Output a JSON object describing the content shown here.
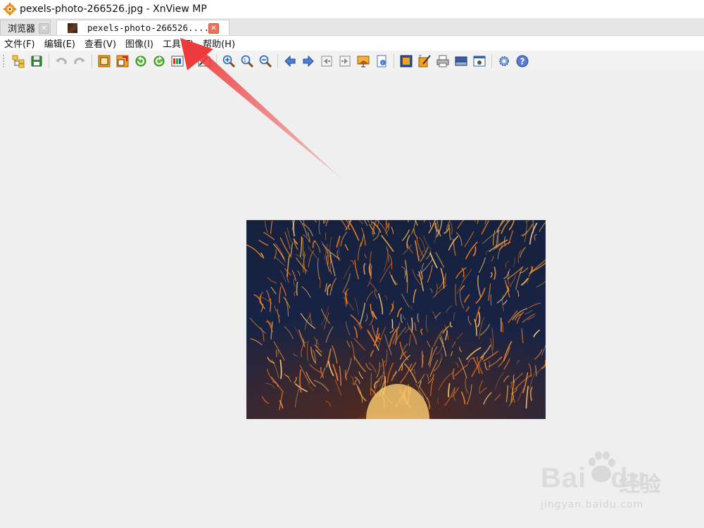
{
  "window": {
    "title": "pexels-photo-266526.jpg - XnView MP"
  },
  "tabs": [
    {
      "label": "浏览器"
    },
    {
      "label": "pexels-photo-266526...."
    }
  ],
  "menu": [
    "文件(F)",
    "编辑(E)",
    "查看(V)",
    "图像(I)",
    "工具(T)",
    "帮助(H)"
  ],
  "toolbar": {
    "buttons": [
      "open-browser-icon",
      "save-icon",
      "undo-icon",
      "redo-icon",
      "crop-icon",
      "resize-icon",
      "rotate-left-icon",
      "rotate-right-icon",
      "adjust-colors-icon",
      "dropdown-arrow-icon",
      "edit-icon",
      "zoom-in-icon",
      "zoom-fit-icon",
      "zoom-out-icon",
      "previous-icon",
      "next-icon",
      "first-icon",
      "last-icon",
      "slideshow-icon",
      "info-icon",
      "fullscreen-icon",
      "batch-icon",
      "print-icon",
      "scanner-icon",
      "capture-icon",
      "settings-icon",
      "help-icon"
    ]
  },
  "watermark": {
    "brand": "Bai",
    "brand2": "du",
    "cn": "经验",
    "url": "jingyan.baidu.com"
  },
  "colors": {
    "arrow": "#ee3a3a",
    "close_active": "#e7755a"
  }
}
